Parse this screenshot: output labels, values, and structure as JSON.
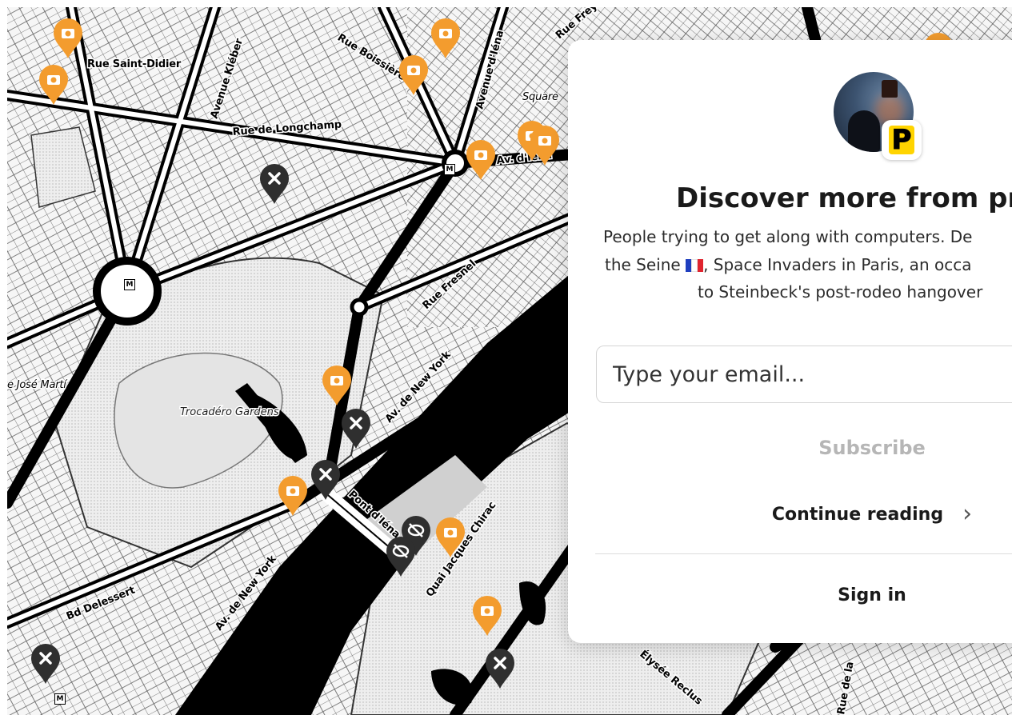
{
  "map": {
    "street_labels": [
      "Rue Saint-Didier",
      "Avenue Kléber",
      "Rue Boissière",
      "Avenue d'Iéna",
      "Rue de Longchamp",
      "Square",
      "Av. d'Iéna",
      "Rue Fresnel",
      "Av. de New York",
      "Pont d'Iéna",
      "Quai Jacques Chirac",
      "Bd Delessert",
      "e José Martí",
      "Rue Freycinet",
      "Élysée Reclus",
      "Rue de la"
    ],
    "park_label": "Trocadéro Gardens",
    "colors": {
      "photo_pin": "#f39c2e",
      "closed_pin": "#2f2f2f",
      "water": "#000000",
      "park_fill": "#d9d9d9"
    },
    "pin_icons": {
      "photo": "camera-icon",
      "closed": "x-icon",
      "hidden": "eye-slash-icon"
    },
    "metro_glyph": "M"
  },
  "modal": {
    "publication_initial": "P",
    "title": "Discover more from pr",
    "description_lines": [
      "People trying to get along with computers. De",
      "the Seine",
      ", Space Invaders in Paris, an occa",
      "to Steinbeck's post-rodeo hangover"
    ],
    "email_placeholder": "Type your email...",
    "subscribe_label": "Subscribe",
    "continue_label": "Continue reading",
    "sign_in_label": "Sign in",
    "flag_colors": [
      "#1f3fbf",
      "#ffffff",
      "#e0242f"
    ]
  }
}
